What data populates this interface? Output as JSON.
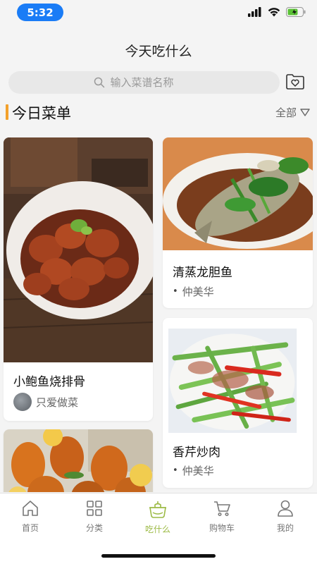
{
  "status_bar": {
    "time": "5:32",
    "time_pill_color": "#1a7cf6",
    "icons": [
      "signal-icon",
      "wifi-icon",
      "battery-icon"
    ]
  },
  "nav": {
    "title": "今天吃什么"
  },
  "search": {
    "placeholder": "输入菜谱名称",
    "icon": "search-icon"
  },
  "favorite_icon": "heart-folder-icon",
  "section": {
    "title": "今日菜单",
    "filter_label": "全部",
    "filter_icon": "triangle-down-icon",
    "accent_color": "#f3a12b"
  },
  "recipes": [
    {
      "title": "小鲍鱼烧排骨",
      "author": "只爱做菜"
    },
    {
      "title": "清蒸龙胆鱼",
      "author": "仲美华"
    },
    {
      "title": "香芹炒肉",
      "author": "仲美华"
    }
  ],
  "tabs": [
    {
      "label": "首页",
      "icon": "home-icon"
    },
    {
      "label": "分类",
      "icon": "grid-icon"
    },
    {
      "label": "吃什么",
      "icon": "pot-icon",
      "active": true
    },
    {
      "label": "购物车",
      "icon": "cart-icon"
    },
    {
      "label": "我的",
      "icon": "user-icon"
    }
  ],
  "colors": {
    "active_tab": "#9cba45",
    "page_bg": "#f4f4f4"
  }
}
